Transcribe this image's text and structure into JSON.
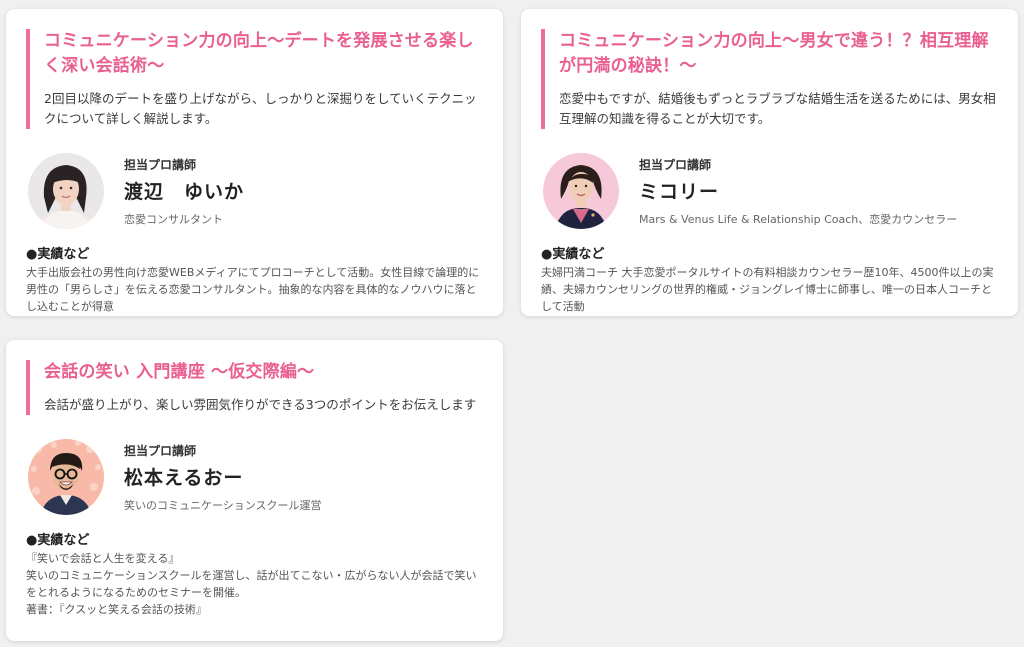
{
  "courses": [
    {
      "title": "コミュニケーション力の向上〜デートを発展させる楽しく深い会話術〜",
      "description": "2回目以降のデートを盛り上げながら、しっかりと深掘りをしていくテクニックについて詳しく解説します。",
      "role": "担当プロ講師",
      "name": "渡辺　ゆいか",
      "affiliation": "恋愛コンサルタント",
      "achievements_heading": "●実績など",
      "achievements": "大手出版会社の男性向け恋愛WEBメディアにてプロコーチとして活動。女性目線で論理的に男性の「男らしさ」を伝える恋愛コンサルタント。抽象的な内容を具体的なノウハウに落とし込むことが得意"
    },
    {
      "title": "コミュニケーション力の向上〜男女で違う！？相互理解が円満の秘訣！〜",
      "description": "恋愛中もですが、結婚後もずっとラブラブな結婚生活を送るためには、男女相互理解の知識を得ることが大切です。",
      "role": "担当プロ講師",
      "name": "ミコリー",
      "affiliation": "Mars & Venus Life & Relationship Coach、恋愛カウンセラー",
      "achievements_heading": "●実績など",
      "achievements": "夫婦円満コーチ 大手恋愛ポータルサイトの有料相談カウンセラー歴10年、4500件以上の実績、夫婦カウンセリングの世界的権威・ジョングレイ博士に師事し、唯一の日本人コーチとして活動"
    },
    {
      "title": "会話の笑い 入門講座 〜仮交際編〜",
      "description": "会話が盛り上がり、楽しい雰囲気作りができる3つのポイントをお伝えします",
      "role": "担当プロ講師",
      "name": "松本えるおー",
      "affiliation": "笑いのコミュニケーションスクール運営",
      "achievements_heading": "●実績など",
      "achievements": "『笑いで会話と人生を変える』\n笑いのコミュニケーションスクールを運営し、話が出てこない・広がらない人が会話で笑いをとれるようになるためのセミナーを開催。\n著書：『クスッと笑える会話の技術』"
    }
  ],
  "colors": {
    "accent": "#ea5f91",
    "accent_bar": "#ef6d9a",
    "card_bg": "#ffffff",
    "page_bg": "#f0f0f0"
  },
  "icons": [
    "instructor-photo-watanabe",
    "instructor-photo-mikori",
    "instructor-photo-matsumoto"
  ]
}
